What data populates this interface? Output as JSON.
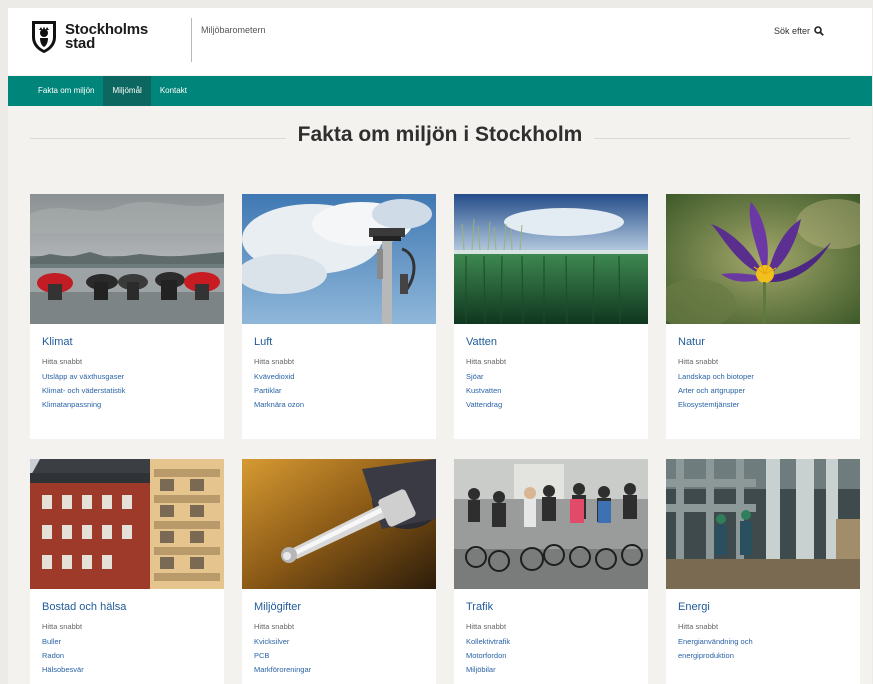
{
  "header": {
    "logo_line1": "Stockholms",
    "logo_line2": "stad",
    "site_name": "Miljöbarometern",
    "search_label": "Sök efter"
  },
  "nav": {
    "items": [
      {
        "label": "Fakta om miljön",
        "active": false
      },
      {
        "label": "Miljömål",
        "active": true
      },
      {
        "label": "Kontakt",
        "active": false
      }
    ]
  },
  "page_title": "Fakta om miljön i Stockholm",
  "cards": [
    {
      "title": "Klimat",
      "sub": "Hitta snabbt",
      "links": [
        "Utsläpp av växthusgaser",
        "Klimat- och väderstatistik",
        "Klimatanpassning"
      ]
    },
    {
      "title": "Luft",
      "sub": "Hitta snabbt",
      "links": [
        "Kvävedioxid",
        "Partiklar",
        "Marknära ozon"
      ]
    },
    {
      "title": "Vatten",
      "sub": "Hitta snabbt",
      "links": [
        "Sjöar",
        "Kustvatten",
        "Vattendrag"
      ]
    },
    {
      "title": "Natur",
      "sub": "Hitta snabbt",
      "links": [
        "Landskap och biotoper",
        "Arter och artgrupper",
        "Ekosystemtjänster"
      ]
    },
    {
      "title": "Bostad och hälsa",
      "sub": "Hitta snabbt",
      "links": [
        "Buller",
        "Radon",
        "Hälsobesvär"
      ]
    },
    {
      "title": "Miljögifter",
      "sub": "Hitta snabbt",
      "links": [
        "Kvicksilver",
        "PCB",
        "Markföroreningar"
      ]
    },
    {
      "title": "Trafik",
      "sub": "Hitta snabbt",
      "links": [
        "Kollektivtrafik",
        "Motorfordon",
        "Miljöbilar"
      ]
    },
    {
      "title": "Energi",
      "sub": "Hitta snabbt",
      "links": [
        "Energianvändning och",
        "energiproduktion"
      ]
    }
  ]
}
